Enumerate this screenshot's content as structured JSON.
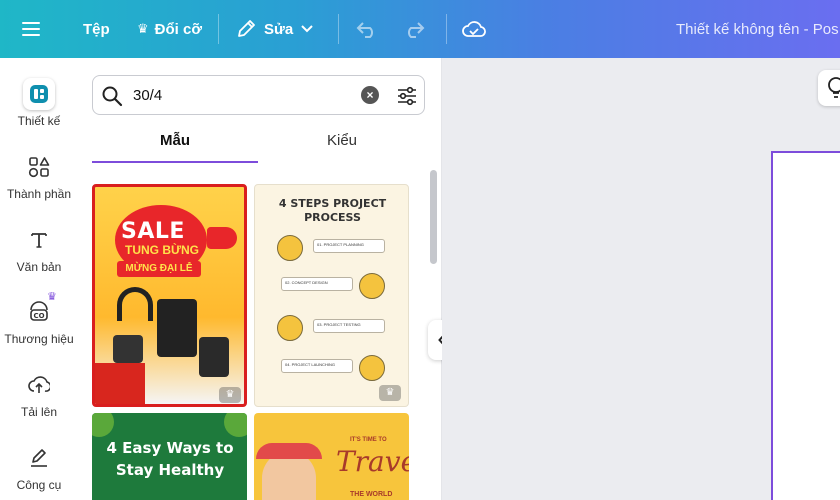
{
  "topbar": {
    "menu_icon": "hamburger-icon",
    "file_label": "Tệp",
    "resize_label": "Đổi cỡ",
    "edit_label": "Sửa",
    "doc_title": "Thiết kế không tên - Pos",
    "colors": {
      "gradient_start": "#1fb7c7",
      "gradient_end": "#6a6ef0"
    }
  },
  "rail": {
    "items": [
      {
        "label": "Thiết kế",
        "icon": "design-icon",
        "active": true
      },
      {
        "label": "Thành phần",
        "icon": "elements-icon"
      },
      {
        "label": "Văn bản",
        "icon": "text-icon"
      },
      {
        "label": "Thương hiệu",
        "icon": "brand-icon"
      },
      {
        "label": "Tải lên",
        "icon": "upload-icon"
      },
      {
        "label": "Công cụ",
        "icon": "draw-icon"
      }
    ]
  },
  "panel": {
    "search": {
      "value": "30/4"
    },
    "tabs": [
      {
        "label": "Mẫu",
        "active": true
      },
      {
        "label": "Kiểu"
      }
    ],
    "accent": "#7d4cdb",
    "templates": [
      {
        "lines": [
          "SALE",
          "TUNG BỪNG",
          "MỪNG ĐẠI LỄ"
        ],
        "premium": true
      },
      {
        "title": "4 STEPS PROJECT PROCESS",
        "steps": [
          "01. PROJECT PLANNING",
          "02. CONCEPT DESIGN",
          "03. PROJECT TESTING",
          "04. PROJECT LAUNCHING"
        ],
        "premium": true
      },
      {
        "title": "4 Easy Ways to Stay Healthy"
      },
      {
        "small": "IT'S TIME TO",
        "title": "Travel",
        "sub": "THE WORLD"
      }
    ]
  }
}
